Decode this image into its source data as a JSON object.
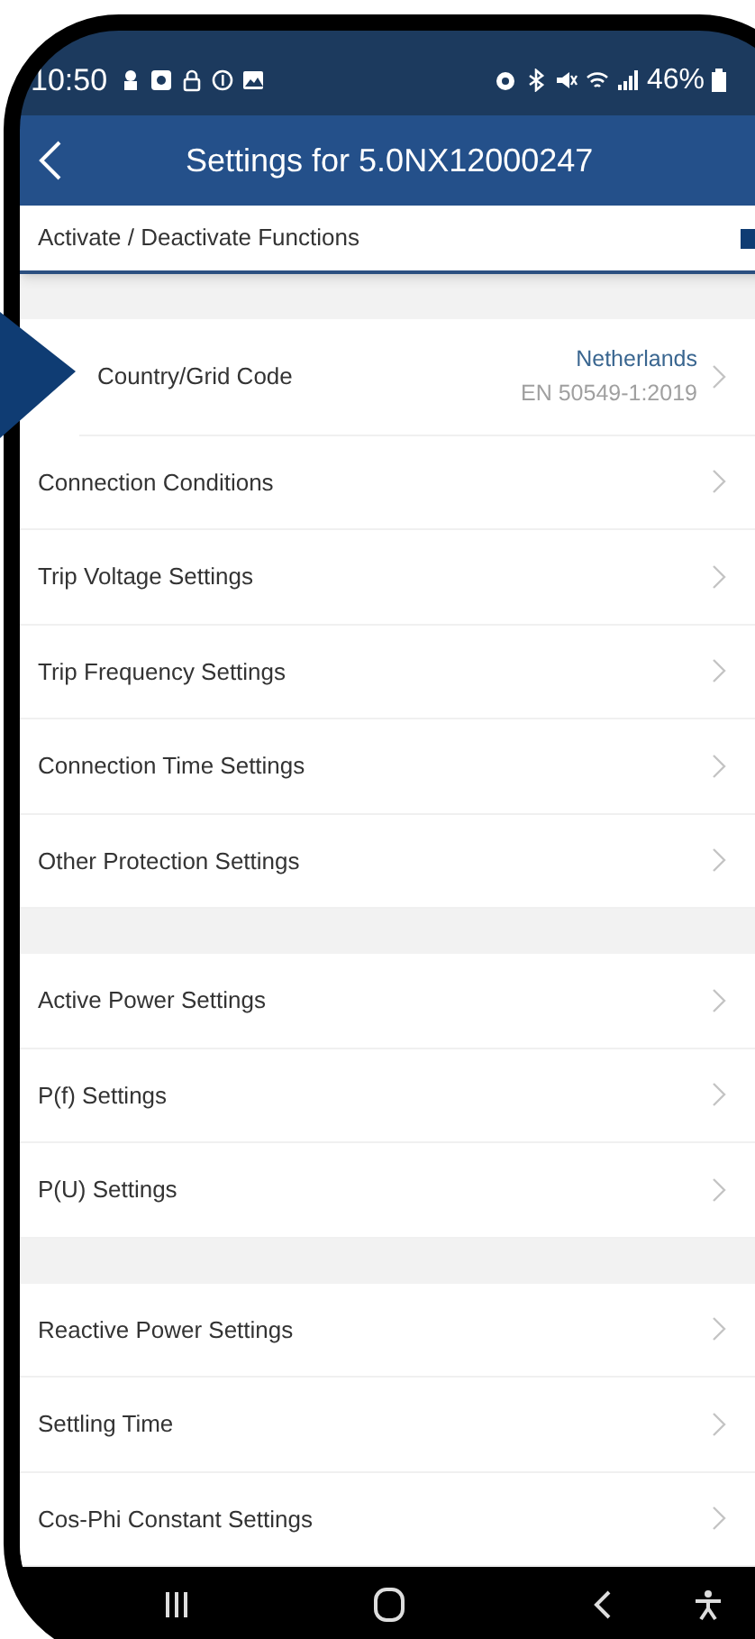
{
  "status_bar": {
    "time": "10:50",
    "battery": "46%"
  },
  "header": {
    "title": "Settings for 5.0NX12000247"
  },
  "activate_row": {
    "label": "Activate / Deactivate Functions"
  },
  "groups": [
    {
      "items": [
        {
          "label": "Country/Grid Code",
          "value": "Netherlands",
          "subvalue": "EN 50549-1:2019"
        },
        {
          "label": "Connection Conditions"
        },
        {
          "label": "Trip Voltage Settings"
        },
        {
          "label": "Trip Frequency Settings"
        },
        {
          "label": "Connection Time Settings"
        },
        {
          "label": "Other Protection Settings"
        }
      ]
    },
    {
      "items": [
        {
          "label": "Active Power Settings"
        },
        {
          "label": "P(f) Settings"
        },
        {
          "label": "P(U) Settings"
        }
      ]
    },
    {
      "items": [
        {
          "label": "Reactive Power Settings"
        },
        {
          "label": "Settling Time"
        },
        {
          "label": "Cos-Phi Constant Settings"
        }
      ]
    }
  ]
}
